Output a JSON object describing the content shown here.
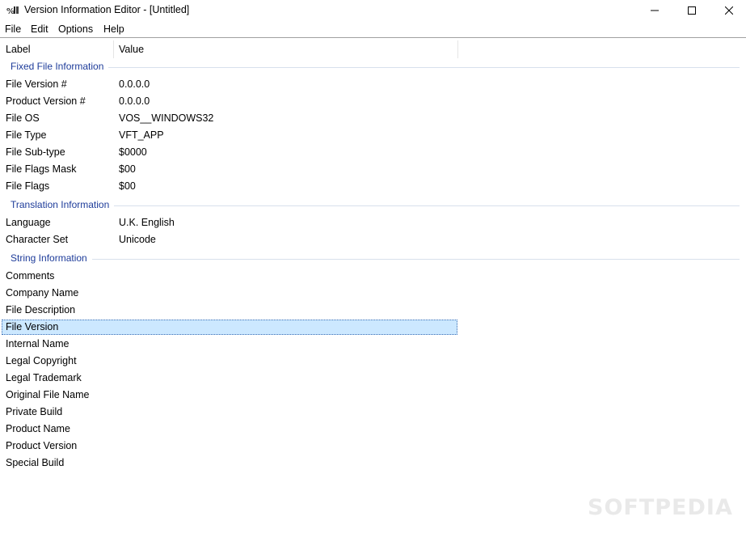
{
  "window": {
    "title": "Version Information Editor - [Untitled]",
    "controls": {
      "minimize": "minimize-icon",
      "maximize": "maximize-icon",
      "close": "close-icon"
    }
  },
  "menu": [
    "File",
    "Edit",
    "Options",
    "Help"
  ],
  "columns": {
    "label": "Label",
    "value": "Value"
  },
  "groups": {
    "fixed": "Fixed File Information",
    "translation": "Translation Information",
    "string": "String Information"
  },
  "fixed_rows": [
    {
      "label": "File Version #",
      "value": "0.0.0.0"
    },
    {
      "label": "Product Version #",
      "value": "0.0.0.0"
    },
    {
      "label": "File OS",
      "value": "VOS__WINDOWS32"
    },
    {
      "label": "File Type",
      "value": "VFT_APP"
    },
    {
      "label": "File Sub-type",
      "value": "$0000"
    },
    {
      "label": "File Flags Mask",
      "value": "$00"
    },
    {
      "label": "File Flags",
      "value": "$00"
    }
  ],
  "translation_rows": [
    {
      "label": "Language",
      "value": "U.K. English"
    },
    {
      "label": "Character Set",
      "value": "Unicode"
    }
  ],
  "string_rows": [
    {
      "label": "Comments",
      "value": ""
    },
    {
      "label": "Company Name",
      "value": ""
    },
    {
      "label": "File Description",
      "value": ""
    },
    {
      "label": "File Version",
      "value": ""
    },
    {
      "label": "Internal Name",
      "value": ""
    },
    {
      "label": "Legal Copyright",
      "value": ""
    },
    {
      "label": "Legal Trademark",
      "value": ""
    },
    {
      "label": "Original File Name",
      "value": ""
    },
    {
      "label": "Private Build",
      "value": ""
    },
    {
      "label": "Product Name",
      "value": ""
    },
    {
      "label": "Product Version",
      "value": ""
    },
    {
      "label": "Special Build",
      "value": ""
    }
  ],
  "watermark": "SOFTPEDIA",
  "colors": {
    "group_label": "#1e3c9a",
    "selection": "#cce8ff",
    "selection_border": "#3c6fb4"
  }
}
